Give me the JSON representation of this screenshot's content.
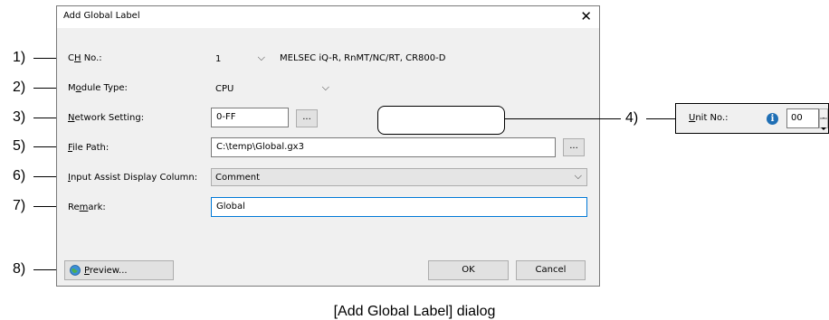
{
  "callouts": [
    "1)",
    "2)",
    "3)",
    "4)",
    "5)",
    "6)",
    "7)",
    "8)"
  ],
  "dialog": {
    "title": "Add Global Label",
    "close_glyph": "✕",
    "ch_no": {
      "label_pre": "C",
      "label_u": "H",
      "label_post": " No.:",
      "value": "1",
      "info": "MELSEC iQ-R, RnMT/NC/RT, CR800-D"
    },
    "module_type": {
      "label_pre": "M",
      "label_u": "o",
      "label_post": "dule Type:",
      "value": "CPU"
    },
    "network_setting": {
      "label_pre": "",
      "label_u": "N",
      "label_post": "etwork Setting:",
      "value": "0-FF",
      "browse": "..."
    },
    "file_path": {
      "label_pre": "",
      "label_u": "F",
      "label_post": "ile Path:",
      "value": "C:\\temp\\Global.gx3",
      "browse": "..."
    },
    "input_assist": {
      "label_pre": "",
      "label_u": "I",
      "label_post": "nput Assist Display Column:",
      "value": "Comment"
    },
    "remark": {
      "label_pre": "Re",
      "label_u": "m",
      "label_post": "ark:",
      "value": "Global"
    },
    "preview_label_u": "P",
    "preview_label_post": "review...",
    "ok_label": "OK",
    "cancel_label": "Cancel"
  },
  "unit_no": {
    "label_u": "U",
    "label_post": "nit No.:",
    "info_glyph": "i",
    "value": "00"
  },
  "caption": "[Add Global Label] dialog",
  "icons": [
    "chevron-down-icon",
    "close-icon",
    "info-icon",
    "preview-globe-icon",
    "spin-up-icon",
    "spin-down-icon"
  ]
}
